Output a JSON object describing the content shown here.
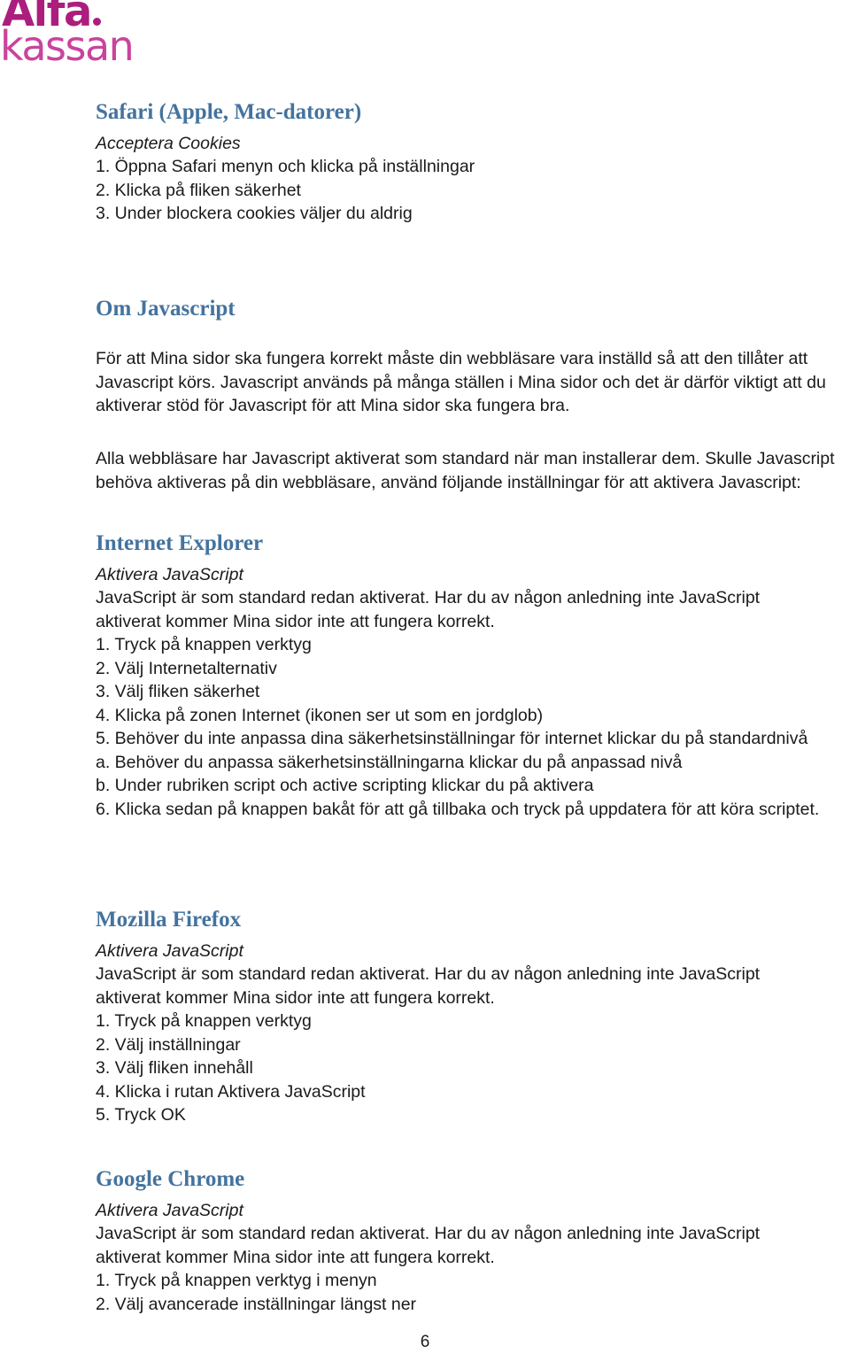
{
  "brand": {
    "logo_line_1": "Alfa",
    "logo_line_2": "kassan",
    "logo_color_primary": "#AB1E7E",
    "logo_color_secondary": "#C9449C",
    "heading_color": "#44739E"
  },
  "sections": {
    "safari": {
      "heading": "Safari (Apple, Mac-datorer)",
      "subheading": "Acceptera Cookies",
      "steps": [
        "1. Öppna Safari menyn och klicka på inställningar",
        "2. Klicka på fliken säkerhet",
        "3. Under blockera cookies väljer du aldrig"
      ]
    },
    "om_javascript": {
      "heading": "Om Javascript",
      "paragraph_1": "För att Mina sidor ska fungera korrekt måste din webbläsare vara inställd så att den tillåter att Javascript körs. Javascript används på många ställen i Mina sidor och det är därför viktigt att du aktiverar stöd för Javascript för att Mina sidor ska fungera bra.",
      "paragraph_2": "Alla webbläsare har Javascript aktiverat som standard när man installerar dem. Skulle Javascript behöva aktiveras på din webbläsare, använd följande inställningar för att aktivera Javascript:"
    },
    "internet_explorer": {
      "heading": "Internet Explorer",
      "subheading": "Aktivera JavaScript",
      "paragraph": "JavaScript är som standard redan aktiverat. Har du av någon anledning inte JavaScript aktiverat kommer Mina sidor inte att fungera korrekt.",
      "steps": [
        "1. Tryck på knappen verktyg",
        "2. Välj Internetalternativ",
        "3. Välj fliken säkerhet",
        "4. Klicka på zonen Internet (ikonen ser ut som en jordglob)",
        "5. Behöver du inte anpassa dina säkerhetsinställningar för internet klickar du på standardnivå",
        "a. Behöver du anpassa säkerhetsinställningarna klickar du på anpassad nivå",
        "b. Under rubriken script och active scripting klickar du på aktivera",
        "6. Klicka sedan på knappen bakåt för att gå tillbaka och tryck på uppdatera för att köra scriptet."
      ]
    },
    "mozilla_firefox": {
      "heading": "Mozilla Firefox",
      "subheading": "Aktivera JavaScript",
      "paragraph": "JavaScript är som standard redan aktiverat. Har du av någon anledning inte JavaScript aktiverat kommer Mina sidor inte att fungera korrekt.",
      "steps": [
        "1. Tryck på knappen verktyg",
        "2. Välj inställningar",
        "3. Välj fliken innehåll",
        "4. Klicka i rutan Aktivera JavaScript",
        "5. Tryck OK"
      ]
    },
    "google_chrome": {
      "heading": "Google Chrome",
      "subheading": "Aktivera JavaScript",
      "paragraph": "JavaScript är som standard redan aktiverat. Har du av någon anledning inte JavaScript aktiverat kommer Mina sidor inte att fungera korrekt.",
      "steps": [
        "1. Tryck på knappen verktyg i menyn",
        "2. Välj avancerade inställningar längst ner"
      ]
    }
  },
  "footer": {
    "page_number": "6"
  }
}
